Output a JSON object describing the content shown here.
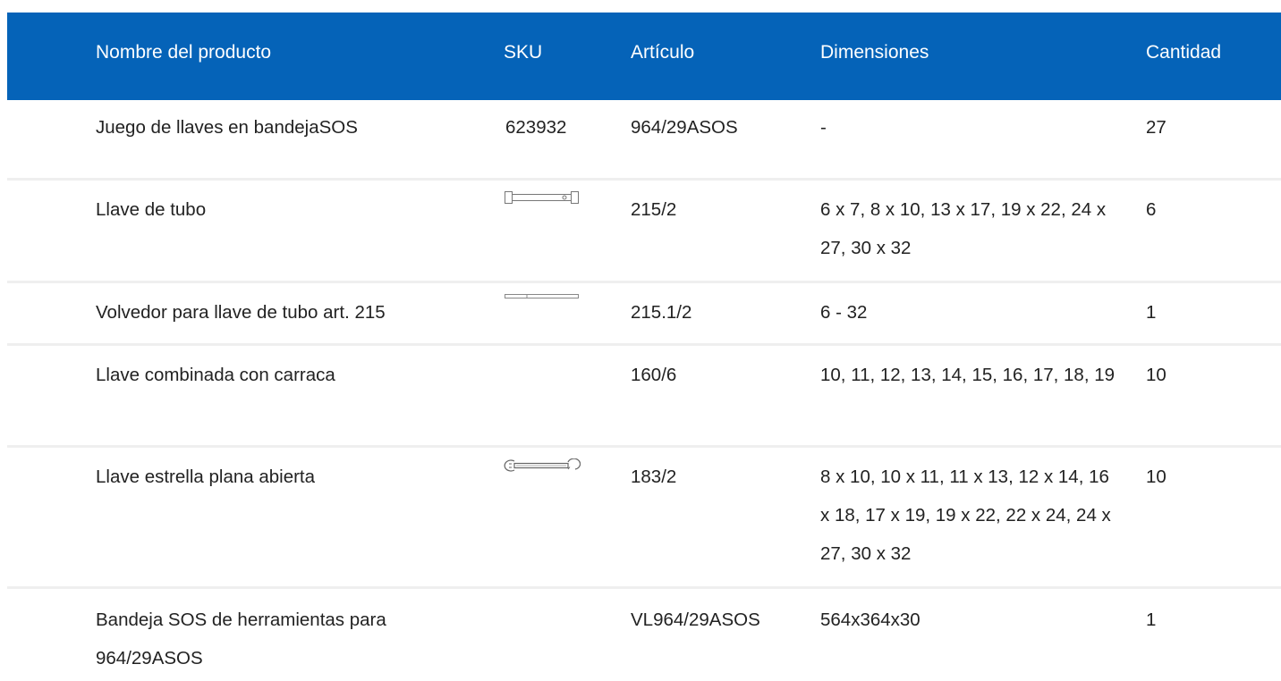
{
  "table": {
    "headers": {
      "name": "Nombre del producto",
      "sku": "SKU",
      "article": "Artículo",
      "dimensions": "Dimensiones",
      "quantity": "Cantidad"
    },
    "header_bg": "#0563b8",
    "rows": [
      {
        "name": "Juego de llaves en bandejaSOS",
        "sku": "623932",
        "article": "964/29ASOS",
        "dimensions": "-",
        "quantity": "27"
      },
      {
        "name": "Llave de tubo",
        "sku_icon": "tube-wrench-icon",
        "article": "215/2",
        "dimensions": "6 x 7, 8 x 10, 13 x 17, 19 x 22, 24 x 27, 30 x 32",
        "quantity": "6"
      },
      {
        "name": "Volvedor para llave de tubo art. 215",
        "sku_icon": "tommy-bar-icon",
        "article": "215.1/2",
        "dimensions": "6 - 32",
        "quantity": "1"
      },
      {
        "name": "Llave combinada con carraca",
        "article": "160/6",
        "dimensions": "10, 11, 12, 13, 14, 15, 16, 17, 18, 19",
        "quantity": "10"
      },
      {
        "name": "Llave estrella plana abierta",
        "sku_icon": "flare-nut-wrench-icon",
        "article": "183/2",
        "dimensions": "8 x 10, 10 x 11, 11 x 13, 12 x 14, 16 x 18, 17 x 19, 19 x 22, 22 x 24, 24 x 27, 30 x 32",
        "quantity": "10"
      },
      {
        "name": "Bandeja SOS de herramientas para 964/29ASOS",
        "article": "VL964/29ASOS",
        "dimensions": "564x364x30",
        "quantity": "1"
      }
    ]
  }
}
